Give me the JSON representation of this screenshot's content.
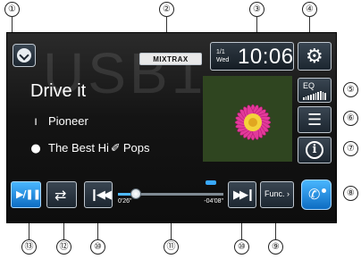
{
  "callouts": {
    "c1": "①",
    "c2": "②",
    "c3": "③",
    "c4": "④",
    "c5": "⑤",
    "c6": "⑥",
    "c7": "⑦",
    "c8": "⑧",
    "c9": "⑨",
    "c10a": "⑩",
    "c10b": "⑩",
    "c11": "⑪",
    "c12": "⑫",
    "c13": "⑬"
  },
  "screen": {
    "source_watermark": "USB1",
    "mixtrax_badge": "MIXTRAX",
    "clock": {
      "month_day": "1/1",
      "weekday": "Wed",
      "time": "10:06"
    },
    "track": {
      "title": "Drive it",
      "artist": "Pioneer",
      "album": "The Best Hi",
      "genre": "Pops"
    },
    "buttons": {
      "eq_label": "EQ",
      "func_label": "Func.",
      "func_arrow": "›"
    },
    "playback": {
      "elapsed": "0'26\"",
      "remaining": "-04'08\"",
      "progress": 0.17
    }
  },
  "icons": {
    "hide": "chevron-down-icon",
    "settings": "gear-icon",
    "eq": "equalizer-icon",
    "list": "list-icon",
    "info": "info-icon",
    "play": "play-pause-icon",
    "repeat": "repeat-icon",
    "prev": "skip-previous-icon",
    "next": "skip-next-icon",
    "phone": "phone-icon",
    "artist": "person-icon",
    "album": "disc-icon",
    "genre": "guitar-icon"
  },
  "colors": {
    "accent_blue": "#1f8fe8",
    "screen_bg": "#141414",
    "text": "#ffffff"
  }
}
